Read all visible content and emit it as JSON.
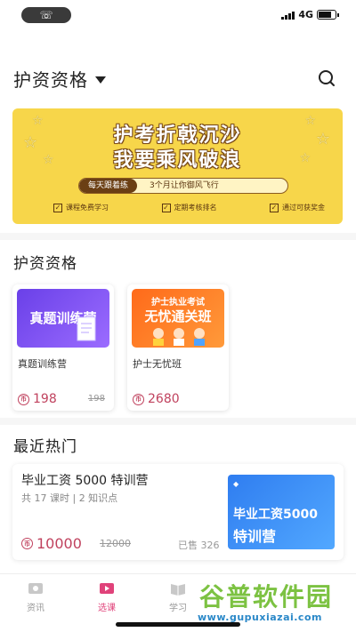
{
  "status_bar": {
    "network": "4G",
    "battery_level": 0.7
  },
  "header": {
    "title": "护资资格"
  },
  "banner": {
    "line1": "护考折戟沉沙",
    "line2": "我要乘风破浪",
    "pill_left": "每天跟着练",
    "pill_right": "3个月让你御风飞行",
    "checks": [
      "课程免费学习",
      "定期考核排名",
      "通过可获奖金"
    ]
  },
  "section_courses": {
    "title": "护资资格",
    "cards": [
      {
        "name": "真题训练营",
        "thumb_title": "真题训练营",
        "price": "198",
        "old_price": "198"
      },
      {
        "name": "护士无忧班",
        "thumb_title": "无忧通关班",
        "thumb_subtitle": "护士执业考试",
        "price": "2680"
      }
    ]
  },
  "section_hot": {
    "title": "最近热门",
    "item": {
      "title": "毕业工资 5000 特训营",
      "meta": "共 17 课时 | 2 知识点",
      "price": "10000",
      "old_price": "12000",
      "sold": "已售 326",
      "thumb_line1": "毕业工资5000",
      "thumb_line2": "特训营"
    }
  },
  "tabs": [
    {
      "label": "资讯",
      "icon": "news-icon",
      "active": false
    },
    {
      "label": "选课",
      "icon": "video-icon",
      "active": true
    },
    {
      "label": "学习",
      "icon": "book-icon",
      "active": false
    }
  ],
  "watermark": {
    "main": "谷普软件园",
    "sub": "www.gupuxiazai.com"
  },
  "colors": {
    "accent": "#e0427a",
    "price": "#c0425e",
    "banner": "#f7d64a"
  }
}
